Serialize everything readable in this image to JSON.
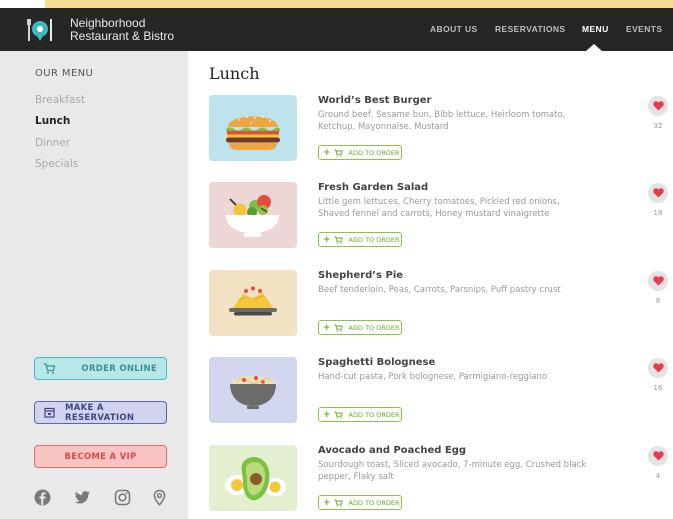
{
  "brand": {
    "line1": "Neighborhood",
    "line2": "Restaurant & Bistro"
  },
  "nav": [
    {
      "label": "ABOUT US",
      "active": false
    },
    {
      "label": "RESERVATIONS",
      "active": false
    },
    {
      "label": "MENU",
      "active": true
    },
    {
      "label": "EVENTS",
      "active": false
    }
  ],
  "sidebar": {
    "title": "OUR MENU",
    "items": [
      {
        "label": "Breakfast",
        "active": false
      },
      {
        "label": "Lunch",
        "active": true
      },
      {
        "label": "Dinner",
        "active": false
      },
      {
        "label": "Specials",
        "active": false
      }
    ],
    "buttons": {
      "order": "ORDER ONLINE",
      "reserve": "MAKE A RESERVATION",
      "vip": "BECOME A VIP"
    },
    "social_icons": [
      "facebook-icon",
      "twitter-icon",
      "instagram-icon",
      "location-pin-icon"
    ]
  },
  "main": {
    "title": "Lunch",
    "add_label": "ADD TO ORDER",
    "items": [
      {
        "name": "World’s Best Burger",
        "description": "Ground beef, Sesame bun, Bibb lettuce, Heirloom tomato, Ketchup, Mayonnaise, Mustard",
        "likes": "32",
        "thumb_bg": "#bfe3ec"
      },
      {
        "name": "Fresh Garden Salad",
        "description": "Little gem lettuces, Cherry tomatoes, Pickled red onions, Shaved fennel and carrots, Honey mustard vinaigrette",
        "likes": "18",
        "thumb_bg": "#ecd6d6"
      },
      {
        "name": "Shepherd’s Pie",
        "description": "Beef tenderloin, Peas, Carrots, Parsnips, Puff pastry crust",
        "likes": "8",
        "thumb_bg": "#f1e2c3"
      },
      {
        "name": "Spaghetti Bolognese",
        "description": "Hand-cut pasta, Pork bolognese, Parmigiano-reggiano",
        "likes": "16",
        "thumb_bg": "#d2d6ee"
      },
      {
        "name": "Avocado and Poached Egg",
        "description": "Sourdough toast, Sliced avocado, 7-minute egg, Crushed black pepper, Flaky salt",
        "likes": "4",
        "thumb_bg": "#e4efcf"
      }
    ]
  },
  "colors": {
    "header_bg": "#262626",
    "sidebar_bg": "#e9e9e9",
    "accent_green": "#8bc34a",
    "heart_red": "#e43d4f"
  }
}
